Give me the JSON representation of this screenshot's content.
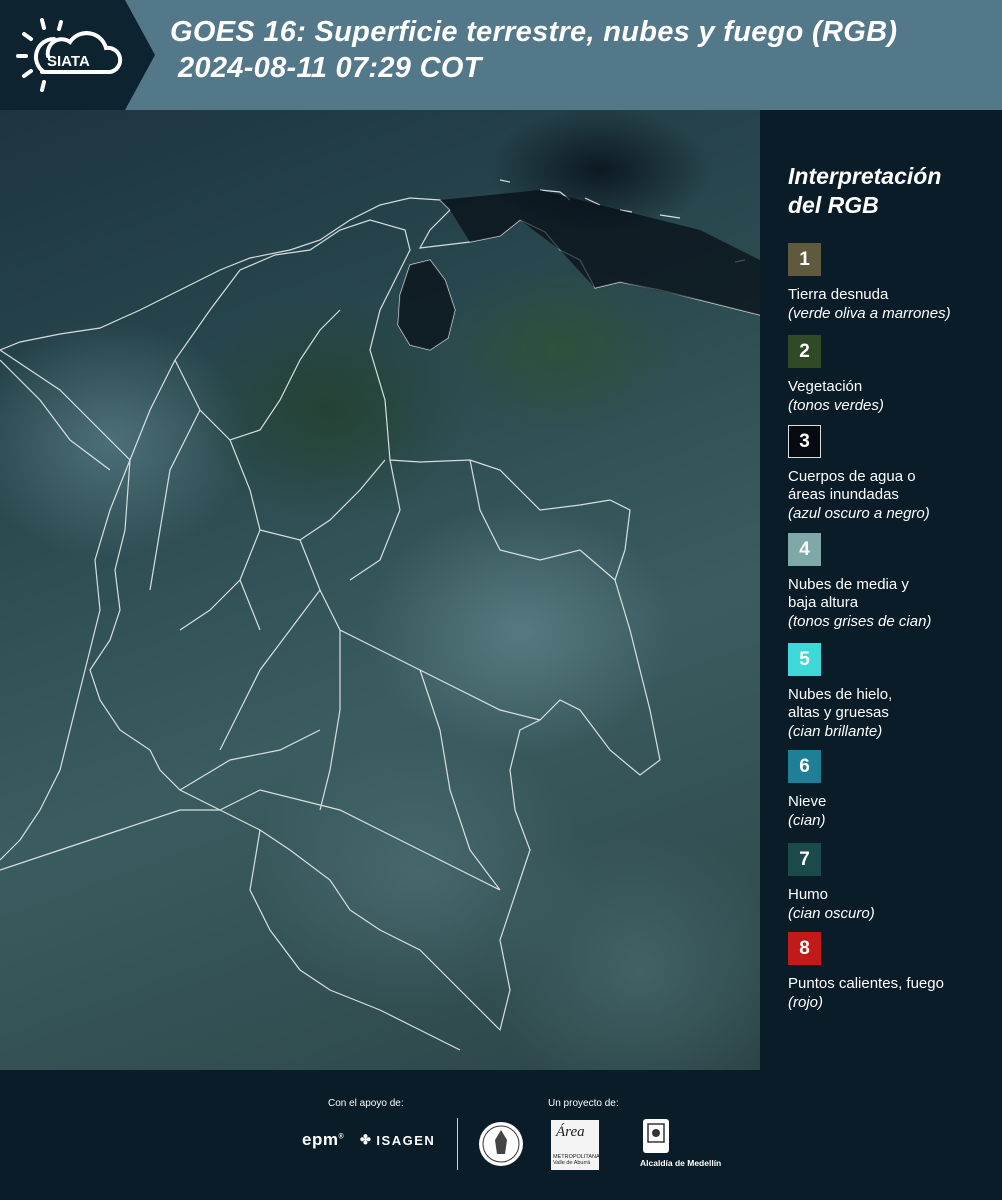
{
  "header": {
    "logo_text": "SIATA",
    "title_line1": "GOES 16: Superficie terrestre, nubes y fuego (RGB)",
    "title_line2": "2024-08-11 07:29 COT"
  },
  "legend": {
    "title_line1": "Interpretación",
    "title_line2": "del RGB",
    "items": [
      {
        "number": "1",
        "label": "Tierra desnuda",
        "sub": "(verde oliva a marrones)",
        "color": "#5f5a3d"
      },
      {
        "number": "2",
        "label": "Vegetación",
        "sub": "(tonos verdes)",
        "color": "#2f4a25"
      },
      {
        "number": "3",
        "label": "Cuerpos de agua o áreas inundadas",
        "sub": "(azul oscuro a negro)",
        "color": "#050b10"
      },
      {
        "number": "4",
        "label": "Nubes de media y baja altura",
        "sub": "(tonos grises de cian)",
        "color": "#7fa8a8"
      },
      {
        "number": "5",
        "label": "Nubes de hielo, altas y gruesas",
        "sub": "(cian brillante)",
        "color": "#3fd8d8"
      },
      {
        "number": "6",
        "label": "Nieve",
        "sub": "(cian)",
        "color": "#1e8098"
      },
      {
        "number": "7",
        "label": "Humo",
        "sub": "(cian oscuro)",
        "color": "#1b4a4a"
      },
      {
        "number": "8",
        "label": "Puntos calientes, fuego",
        "sub": "(rojo)",
        "color": "#c21a1a"
      }
    ]
  },
  "footer": {
    "support_label": "Con el apoyo de:",
    "project_label": "Un proyecto de:",
    "epm": "epm",
    "isagen": "ISAGEN",
    "area_name": "Área",
    "area_sub": "METROPOLITANA Valle de Aburrá",
    "alcaldia": "Alcaldía de Medellín"
  }
}
